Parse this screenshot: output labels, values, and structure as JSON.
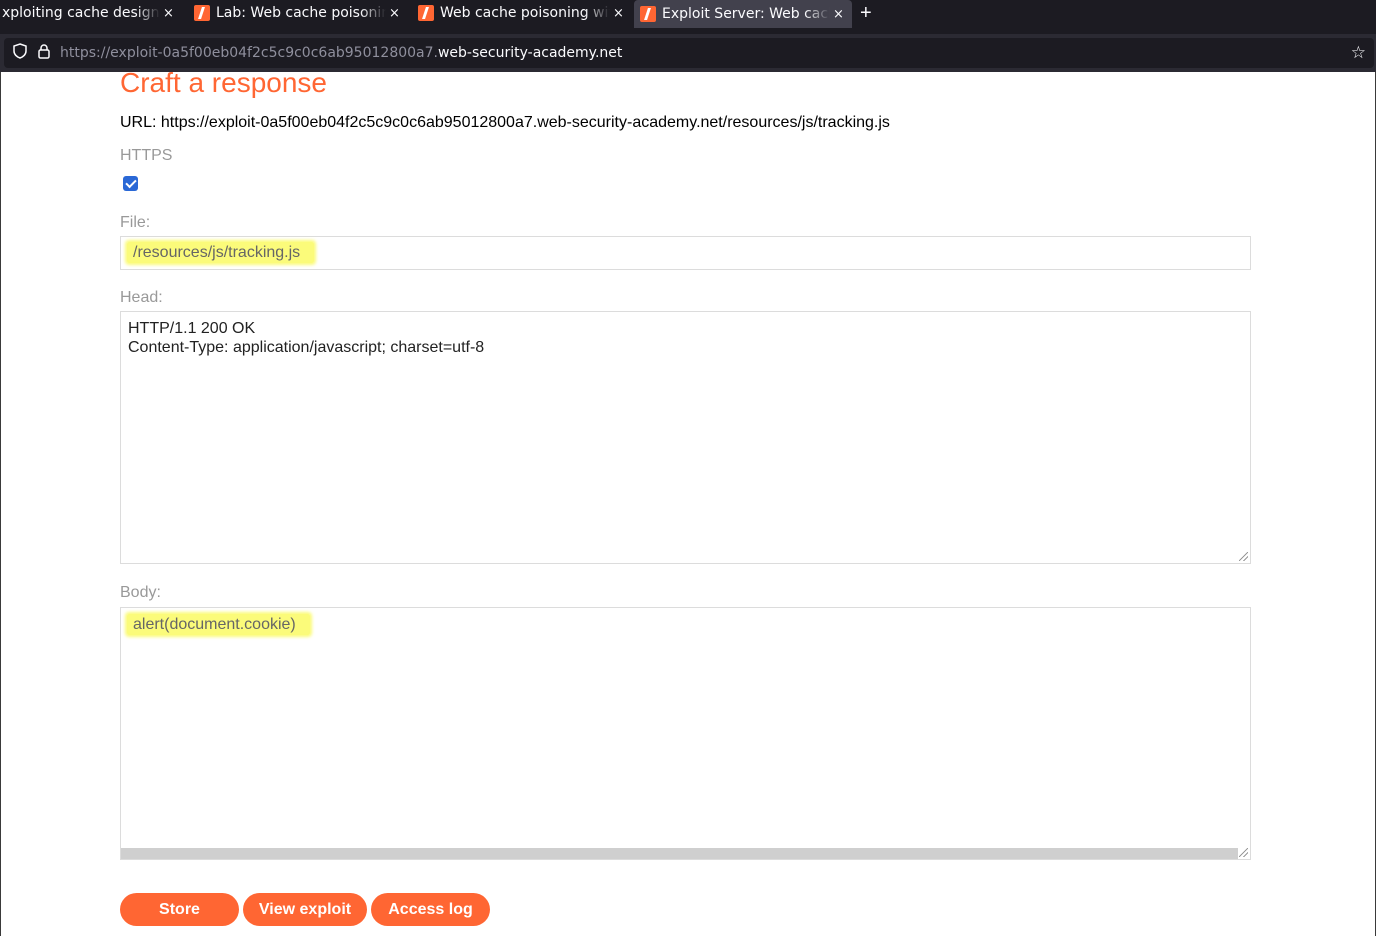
{
  "browser": {
    "tabs": [
      {
        "title": "xploiting cache design fl"
      },
      {
        "title": "Lab: Web cache poisoning"
      },
      {
        "title": "Web cache poisoning wit"
      },
      {
        "title": "Exploit Server: Web cache"
      }
    ],
    "new_tab": "+",
    "close_glyph": "×",
    "url_prefix": "https://exploit-0a5f00eb04f2c5c9c0c6ab95012800a7.",
    "url_host": "web-security-academy.net",
    "icons": [
      "shield-icon",
      "lock-icon",
      "bookmark-star-icon",
      "tab-favicon"
    ]
  },
  "page": {
    "heading": "Craft a response",
    "url_line": "URL: https://exploit-0a5f00eb04f2c5c9c0c6ab95012800a7.web-security-academy.net/resources/js/tracking.js",
    "https_label": "HTTPS",
    "https_checked": true,
    "file_label": "File:",
    "file_value": "/resources/js/tracking.js",
    "head_label": "Head:",
    "head_line1": "HTTP/1.1 200 OK",
    "head_line2": "Content-Type: application/javascript; charset=utf-8",
    "body_label": "Body:",
    "body_value": "alert(document.cookie)",
    "buttons": {
      "store": "Store",
      "view_exploit": "View exploit",
      "access_log": "Access log"
    }
  },
  "colors": {
    "accent": "#ff6633",
    "highlight": "#fbfb7a",
    "checkbox": "#2a68d6"
  }
}
